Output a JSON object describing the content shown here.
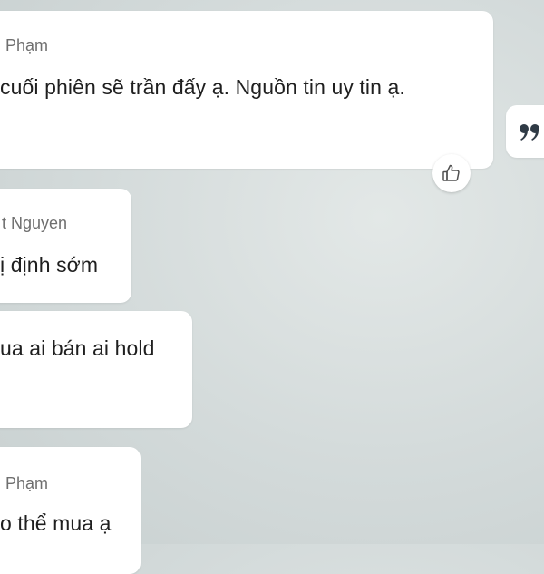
{
  "messages": [
    {
      "sender": "Phạm",
      "text": "cuối phiên sẽ trần đấy ạ. Nguồn tin uy tin ạ."
    },
    {
      "sender": "t Nguyen",
      "text": "ị định sớm"
    },
    {
      "sender": "",
      "text": "ua ai bán ai hold"
    },
    {
      "sender": "Phạm",
      "text": "o thể mua ạ"
    }
  ],
  "icons": {
    "like": "thumbs-up-icon",
    "quote": "quote-icon"
  },
  "colors": {
    "background": "#d6dddc",
    "bubble": "#ffffff",
    "sender_text": "#6f6f6f",
    "message_text": "#1f1f1f"
  }
}
